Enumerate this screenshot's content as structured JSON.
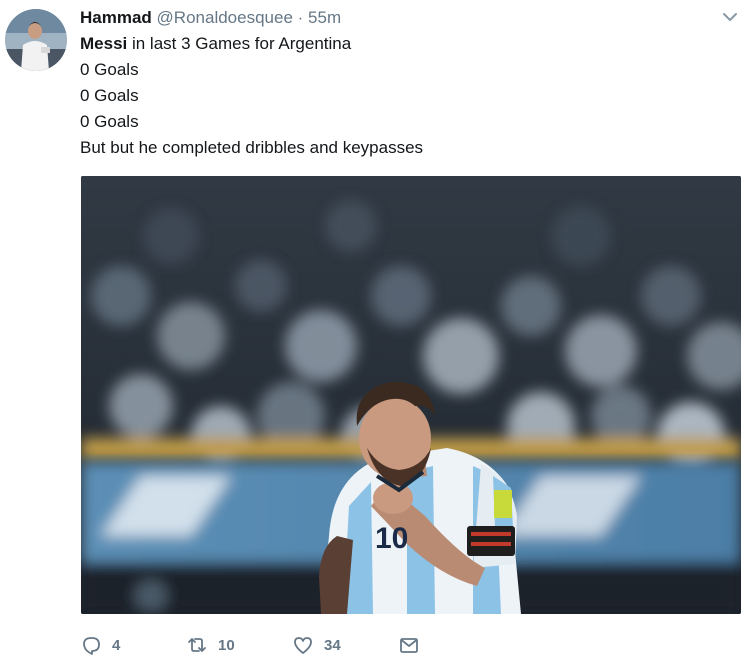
{
  "tweet": {
    "author_name": "Hammad",
    "author_handle": "@Ronaldoesquee",
    "separator": "·",
    "timestamp": "55m",
    "lines": [
      {
        "bold": "Messi",
        "rest": " in last 3 Games for Argentina"
      },
      {
        "text": "0 Goals"
      },
      {
        "text": "0 Goals"
      },
      {
        "text": "0 Goals"
      },
      {
        "text": "But but he completed dribbles and keypasses"
      }
    ],
    "media": {
      "jersey_number": "10"
    }
  },
  "actions": {
    "reply_count": "4",
    "retweet_count": "10",
    "like_count": "34"
  },
  "icons": {
    "caret": "chevron-down-icon",
    "reply": "reply-icon",
    "retweet": "retweet-icon",
    "like": "heart-icon",
    "message": "envelope-icon"
  },
  "colors": {
    "text": "#14171a",
    "secondary": "#657786",
    "jersey_blue": "#8cc2e6"
  }
}
